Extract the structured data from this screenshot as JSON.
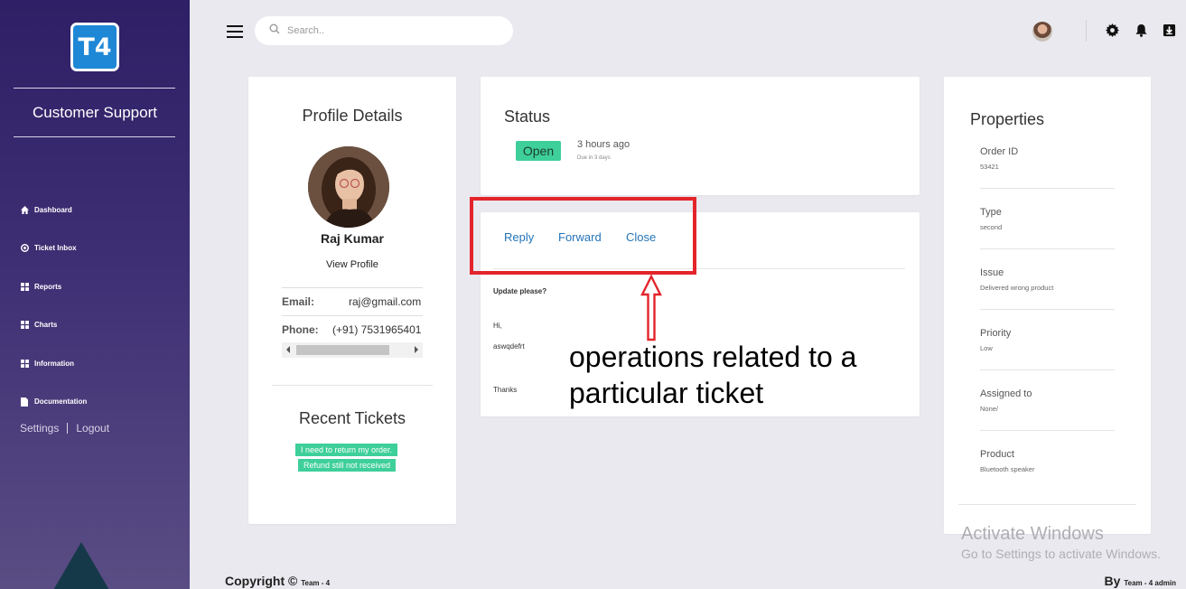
{
  "sidebar": {
    "logo_text": "T4",
    "brand": "Customer Support",
    "items": [
      {
        "label": "Dashboard",
        "icon": "home-icon"
      },
      {
        "label": "Ticket Inbox",
        "icon": "inbox-icon"
      },
      {
        "label": "Reports",
        "icon": "grid-icon"
      },
      {
        "label": "Charts",
        "icon": "grid-icon"
      },
      {
        "label": "Information",
        "icon": "grid-icon"
      },
      {
        "label": "Documentation",
        "icon": "document-icon"
      }
    ],
    "settings_label": "Settings",
    "logout_label": "Logout"
  },
  "topbar": {
    "search_placeholder": "Search..",
    "icons": [
      "menu-icon",
      "search-icon",
      "user-avatar",
      "gear-icon",
      "bell-icon",
      "download-icon"
    ]
  },
  "profile": {
    "title": "Profile Details",
    "name": "Raj Kumar",
    "view_profile": "View Profile",
    "email_label": "Email:",
    "email_value": "raj@gmail.com",
    "phone_label": "Phone:",
    "phone_value": "(+91) 7531965401",
    "recent_title": "Recent Tickets",
    "recent_tickets": [
      "I need to return my order.",
      "Refund still not received"
    ]
  },
  "status": {
    "title": "Status",
    "badge": "Open",
    "time": "3 hours ago",
    "due": "Due in 3 days"
  },
  "ticket": {
    "actions": [
      "Reply",
      "Forward",
      "Close"
    ],
    "subject": "Update please?",
    "greeting": "Hi,",
    "body": "aswqdefrt",
    "signoff": "Thanks"
  },
  "properties": {
    "title": "Properties",
    "items": [
      {
        "label": "Order ID",
        "value": "53421"
      },
      {
        "label": "Type",
        "value": "second"
      },
      {
        "label": "Issue",
        "value": "Delivered wrong product"
      },
      {
        "label": "Priority",
        "value": "Low"
      },
      {
        "label": "Assigned to",
        "value": "None/"
      },
      {
        "label": "Product",
        "value": "Bluetooth speaker"
      }
    ]
  },
  "annotation": {
    "text": "operations related to a particular ticket",
    "color": "#e3242b"
  },
  "watermark": {
    "line1": "Activate Windows",
    "line2": "Go to Settings to activate Windows."
  },
  "footer": {
    "left_main": "Copyright © ",
    "left_small": "Team - 4",
    "right_main": "By ",
    "right_small": "Team - 4 admin"
  },
  "colors": {
    "accent_green": "#3ecf9b",
    "link_blue": "#2474b8",
    "sidebar_top": "#2e1f66",
    "logo_blue": "#1e87d6"
  }
}
